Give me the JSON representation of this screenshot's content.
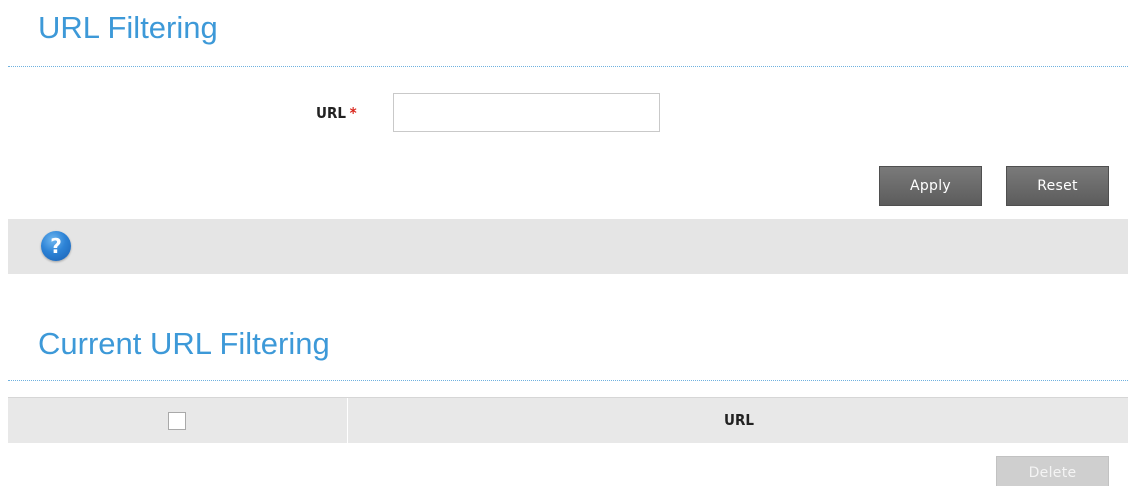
{
  "url_filtering": {
    "title": "URL Filtering",
    "url_label": "URL",
    "required_marker": "*",
    "url_value": "",
    "url_placeholder": "",
    "apply_label": "Apply",
    "reset_label": "Reset"
  },
  "help": {
    "icon": "question-icon",
    "icon_glyph": "?"
  },
  "current_url_filtering": {
    "title": "Current URL Filtering",
    "columns": [
      "",
      "URL"
    ],
    "rows": [],
    "delete_label": "Delete"
  },
  "colors": {
    "title_blue": "#3d99d8",
    "button_gray": "#666666",
    "help_bar": "#e5e5e5",
    "required_red": "#d9261c"
  }
}
